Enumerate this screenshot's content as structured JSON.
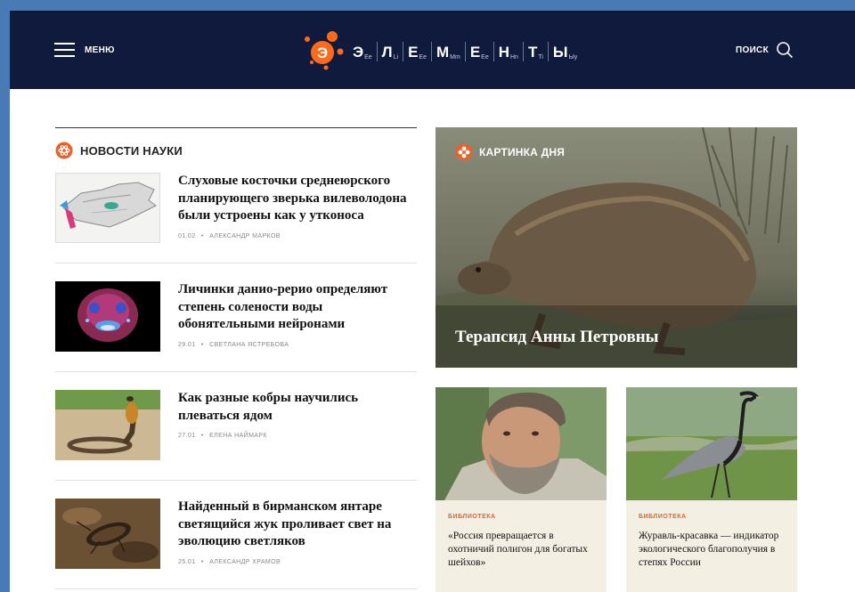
{
  "header": {
    "menu_label": "МЕНЮ",
    "search_label": "ПОИСК",
    "logo_letters": [
      {
        "big": "Э",
        "small": "Ee"
      },
      {
        "big": "Л",
        "small": "Li"
      },
      {
        "big": "Е",
        "small": "Ee"
      },
      {
        "big": "М",
        "small": "Mm"
      },
      {
        "big": "Е",
        "small": "Ee"
      },
      {
        "big": "Н",
        "small": "Hn"
      },
      {
        "big": "Т",
        "small": "Ti"
      },
      {
        "big": "Ы",
        "small": "Ыy"
      }
    ],
    "logo_mark": "Э",
    "logo_color": "#ff6a1a",
    "background": "#0f1a3d"
  },
  "news": {
    "section_title": "НОВОСТИ НАУКИ",
    "section_icon": "atom-icon",
    "items": [
      {
        "title": "Слуховые косточки среднеюрского планирующего зверька вилеволодона были устроены как у утконоса",
        "date": "01.02",
        "author": "АЛЕКСАНДР МАРКОВ",
        "thumb": "skull-scan"
      },
      {
        "title": "Личинки данио-рерио определяют степень солености воды обонятельными нейронами",
        "date": "29.01",
        "author": "СВЕТЛАНА ЯСТРЕБОВА",
        "thumb": "fluorescent-larva"
      },
      {
        "title": "Как разные кобры научились плеваться ядом",
        "date": "27.01",
        "author": "ЕЛЕНА НАЙМАРК",
        "thumb": "cobra"
      },
      {
        "title": "Найденный в бирманском янтаре светящийся жук проливает свет на эволюцию светляков",
        "date": "25.01",
        "author": "АЛЕКСАНДР ХРАМОВ",
        "thumb": "amber-beetle"
      }
    ],
    "meta_separator": "•"
  },
  "picture_of_day": {
    "label": "КАРТИНКА ДНЯ",
    "title": "Терапсид Анны Петровны",
    "icon": "flower-icon"
  },
  "cards": [
    {
      "category": "БИБЛИОТЕКА",
      "title": "«Россия превращается в охотничий полигон для богатых шейхов»",
      "image": "bearded-man"
    },
    {
      "category": "БИБЛИОТЕКА",
      "title": "Журавль-красавка — индикатор экологического благополучия в степях России",
      "image": "crane"
    }
  ],
  "colors": {
    "accent": "#e8632b",
    "frame": "#4a7ab5",
    "card_bg": "#f4efe3"
  }
}
